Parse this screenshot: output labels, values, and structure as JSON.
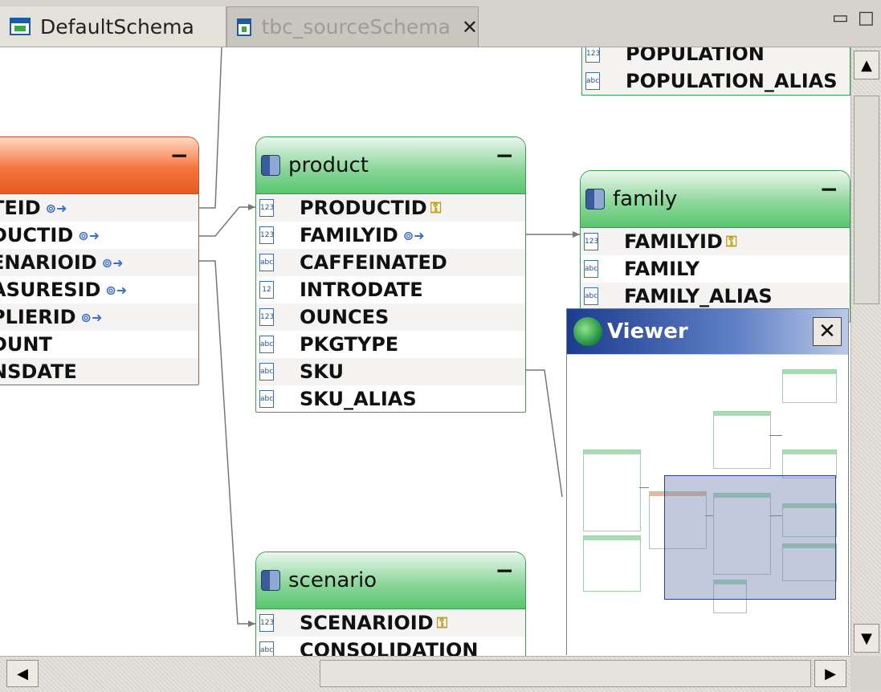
{
  "tabs": [
    {
      "label": "DefaultSchema",
      "active": true
    },
    {
      "label": "tbc_sourceSchema",
      "active": false,
      "close": "✕"
    }
  ],
  "window_controls": {
    "minimize": "▭",
    "maximize": "□"
  },
  "entities": {
    "orange": {
      "title": "",
      "collapse": "−",
      "rows": [
        {
          "label": "TEID",
          "suffix": "⊚➜"
        },
        {
          "label": "DUCTID",
          "suffix": "⊚➜"
        },
        {
          "label": "ENARIOID",
          "suffix": "⊚➜"
        },
        {
          "label": "ASURESID",
          "suffix": "⊚➜"
        },
        {
          "label": "PLIERID",
          "suffix": "⊚➜"
        },
        {
          "label": "DUNT",
          "suffix": ""
        },
        {
          "label": "NSDATE",
          "suffix": ""
        }
      ]
    },
    "product": {
      "title": "product",
      "collapse": "−",
      "rows": [
        {
          "label": "PRODUCTID",
          "type": "123",
          "key": "⚿"
        },
        {
          "label": "FAMILYID",
          "type": "123",
          "fk": "⊚➜"
        },
        {
          "label": "CAFFEINATED",
          "type": "abc"
        },
        {
          "label": "INTRODATE",
          "type": "12"
        },
        {
          "label": "OUNCES",
          "type": "123"
        },
        {
          "label": "PKGTYPE",
          "type": "abc"
        },
        {
          "label": "SKU",
          "type": "abc"
        },
        {
          "label": "SKU_ALIAS",
          "type": "abc"
        }
      ]
    },
    "family": {
      "title": "family",
      "collapse": "−",
      "rows": [
        {
          "label": "FAMILYID",
          "type": "123",
          "key": "⚿"
        },
        {
          "label": "FAMILY",
          "type": "abc"
        },
        {
          "label": "FAMILY_ALIAS",
          "type": "abc"
        }
      ]
    },
    "population": {
      "rows": [
        {
          "label": "POPULATION",
          "type": "123"
        },
        {
          "label": "POPULATION_ALIAS",
          "type": "abc"
        }
      ]
    },
    "scenario": {
      "title": "scenario",
      "collapse": "−",
      "rows": [
        {
          "label": "SCENARIOID",
          "type": "123",
          "key": "⚿"
        },
        {
          "label": "CONSOLIDATION",
          "type": "abc"
        }
      ]
    }
  },
  "viewer": {
    "title": "Viewer",
    "close": "✕"
  },
  "scroll": {
    "up": "▲",
    "down": "▼",
    "left": "◀",
    "right": "▶"
  }
}
